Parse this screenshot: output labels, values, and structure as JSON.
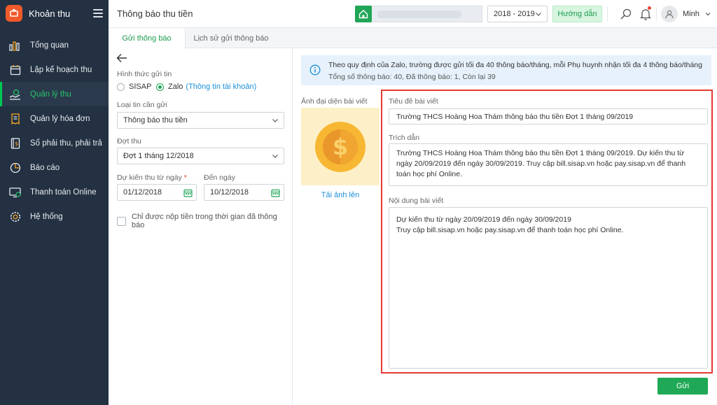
{
  "sidebar": {
    "brand": "Khoản thu",
    "items": [
      {
        "label": "Tổng quan",
        "icon": "chart-bars-icon"
      },
      {
        "label": "Lập kế hoạch thu",
        "icon": "calendar-icon"
      },
      {
        "label": "Quản lý thu",
        "icon": "money-hand-icon",
        "active": true
      },
      {
        "label": "Quản lý hóa đơn",
        "icon": "invoice-icon"
      },
      {
        "label": "Sổ phải thu, phải trả",
        "icon": "ledger-book-icon"
      },
      {
        "label": "Báo cáo",
        "icon": "pie-chart-icon"
      },
      {
        "label": "Thanh toán Online",
        "icon": "online-payment-icon"
      },
      {
        "label": "Hệ thống",
        "icon": "gear-icon"
      }
    ]
  },
  "header": {
    "title": "Thông báo thu tiền",
    "year": "2018 - 2019",
    "guide": "Hướng dẫn",
    "user": "Minh"
  },
  "tabs": [
    "Gửi thông báo",
    "Lịch sử gửi thông báo"
  ],
  "form": {
    "method_label": "Hình thức gửi tin",
    "method_sisap": "SISAP",
    "method_zalo": "Zalo",
    "account_link": "(Thông tin tài khoản)",
    "type_label": "Loại tin cần gửi",
    "type_value": "Thông báo thu tiền",
    "period_label": "Đợt thu",
    "period_value": "Đợt 1 tháng 12/2018",
    "from_label": "Dự kiến thu từ ngày",
    "from_required": "*",
    "from_value": "01/12/2018",
    "to_label": "Đến ngày",
    "to_value": "10/12/2018",
    "checkbox_label": "Chỉ được nộp tiền trong thời gian đã thông báo"
  },
  "info": {
    "line1": "Theo quy định của Zalo, trường được gửi tối đa 40 thông báo/tháng, mỗi Phụ huynh nhận tối đa 4 thông báo/tháng",
    "line2": "Tổng số thông báo: 40, Đã thông báo: 1, Còn lại 39"
  },
  "article": {
    "image_label": "Ảnh đại diện bài viết",
    "upload": "Tải ảnh lên",
    "title_label": "Tiêu đề bài viết",
    "title_value": "Trường THCS Hoàng Hoa Thám thông báo thu tiền Đợt 1 tháng 09/2019",
    "excerpt_label": "Trích dẫn",
    "excerpt_value": "Trường THCS Hoàng Hoa Thám thông báo thu tiền Đợt 1 tháng 09/2019. Dự kiến thu từ ngày 20/09/2019 đến ngày 30/09/2019. Truy cập bill.sisap.vn hoặc pay.sisap.vn để thanh toán học phí Online.",
    "content_label": "Nội dung bài viết",
    "content_line1": "Dự kiến thu từ ngày 20/09/2019 đến ngày 30/09/2019",
    "content_line2": "Truy cập bill.sisap.vn hoặc pay.sisap.vn để thanh toán học phí Online."
  },
  "send": "Gửi",
  "colors": {
    "sidebar": "#233142",
    "accent": "#21a557",
    "link": "#1a8fd8",
    "highlight": "#e53935"
  }
}
